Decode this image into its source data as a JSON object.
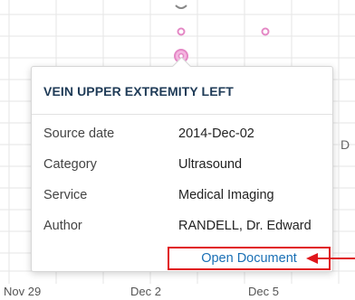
{
  "x_axis": {
    "ticks": [
      "Nov 29",
      "Dec 2",
      "Dec 5"
    ]
  },
  "partial_edge_text": "D",
  "popover": {
    "title": "VEIN UPPER EXTREMITY LEFT",
    "rows": [
      {
        "label": "Source date",
        "value": "2014-Dec-02"
      },
      {
        "label": "Category",
        "value": "Ultrasound"
      },
      {
        "label": "Service",
        "value": "Medical Imaging"
      },
      {
        "label": "Author",
        "value": "RANDELL, Dr. Edward"
      }
    ],
    "link_label": "Open Document"
  },
  "colors": {
    "marker": "#e487c5",
    "marker_selected_fill": "#f4b6e0",
    "title": "#1f3b57",
    "link": "#1a6fb5",
    "highlight": "#e0161b"
  }
}
